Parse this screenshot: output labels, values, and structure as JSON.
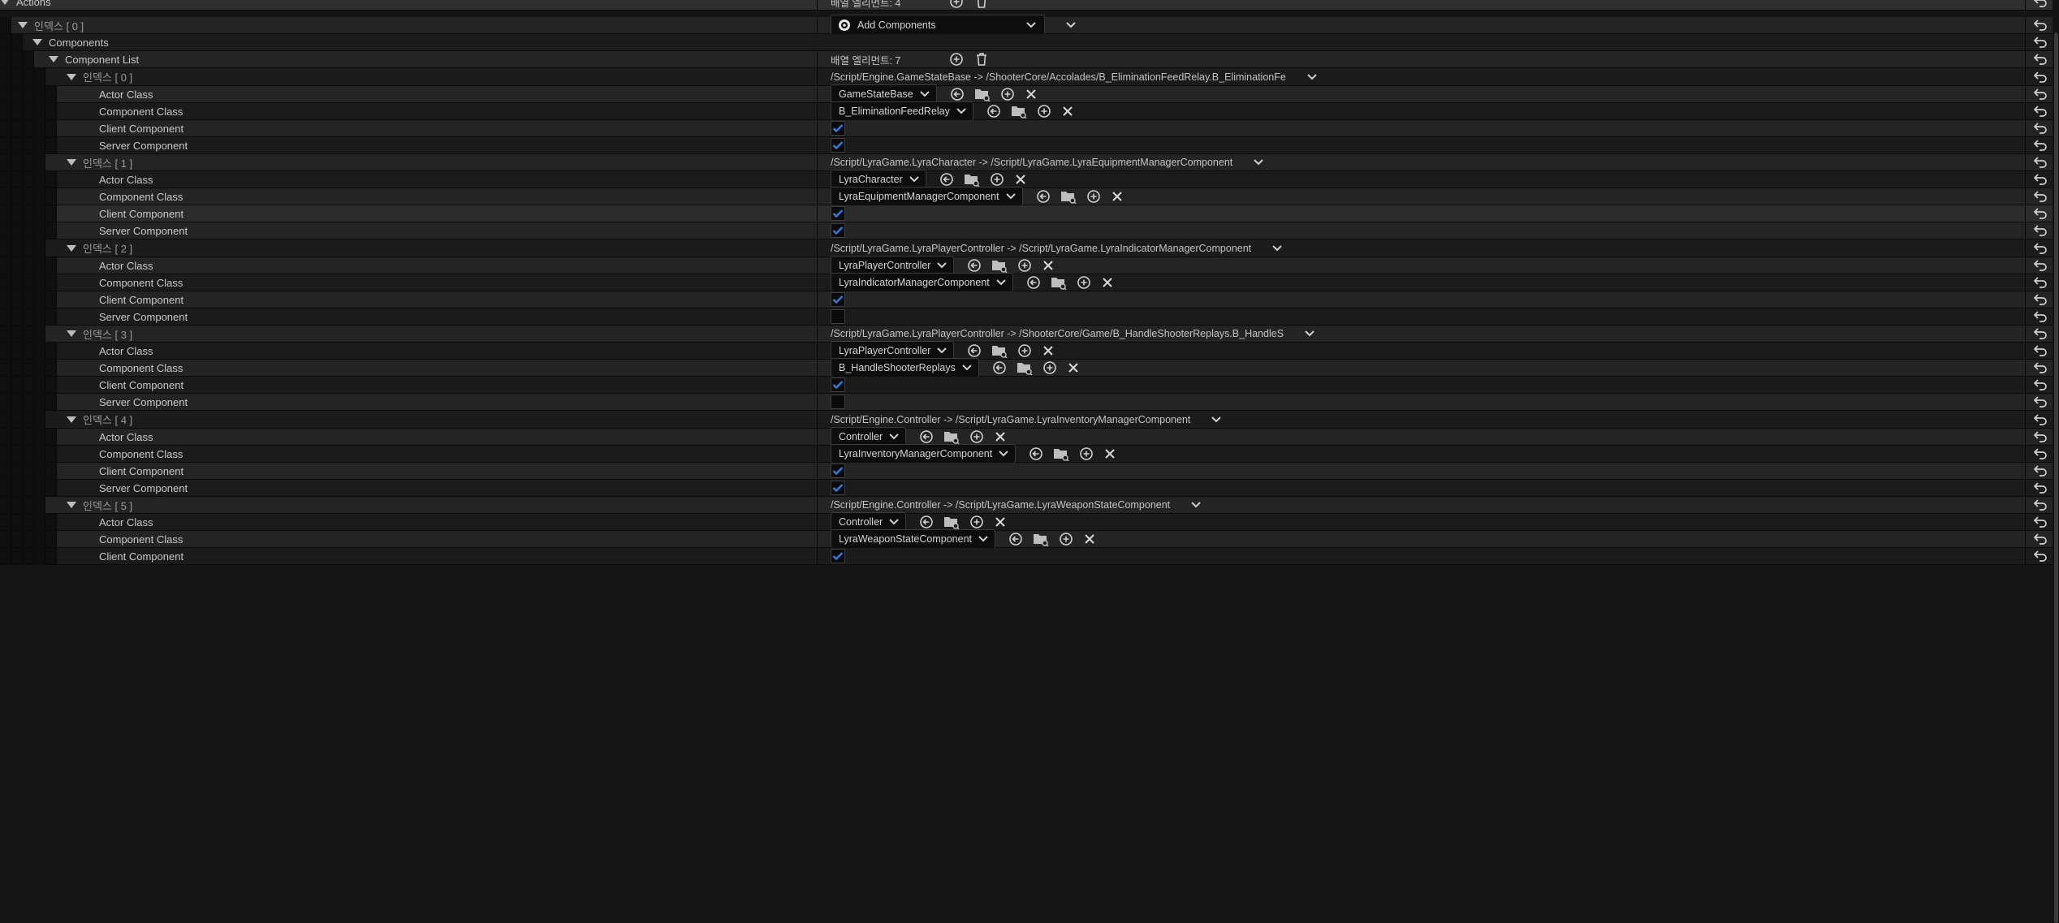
{
  "header": {
    "actions_label": "Actions",
    "actions_count": "배열 엘리먼트: 4",
    "index0_label": "인덱스 [ 0 ]",
    "add_components_label": "Add Components",
    "components_label": "Components",
    "component_list_label": "Component List",
    "component_list_count": "배열 엘리먼트: 7"
  },
  "labels": {
    "actor_class": "Actor Class",
    "component_class": "Component Class",
    "client_component": "Client Component",
    "server_component": "Server Component"
  },
  "entries": [
    {
      "index_label": "인덱스 [ 0 ]",
      "summary": "/Script/Engine.GameStateBase -> /ShooterCore/Accolades/B_EliminationFeedRelay.B_EliminationFe",
      "actor_class": "GameStateBase",
      "component_class": "B_EliminationFeedRelay",
      "client": true,
      "server": true
    },
    {
      "index_label": "인덱스 [ 1 ]",
      "summary": "/Script/LyraGame.LyraCharacter -> /Script/LyraGame.LyraEquipmentManagerComponent",
      "actor_class": "LyraCharacter",
      "component_class": "LyraEquipmentManagerComponent",
      "client": true,
      "server": true
    },
    {
      "index_label": "인덱스 [ 2 ]",
      "summary": "/Script/LyraGame.LyraPlayerController -> /Script/LyraGame.LyraIndicatorManagerComponent",
      "actor_class": "LyraPlayerController",
      "component_class": "LyraIndicatorManagerComponent",
      "client": true,
      "server": false
    },
    {
      "index_label": "인덱스 [ 3 ]",
      "summary": "/Script/LyraGame.LyraPlayerController -> /ShooterCore/Game/B_HandleShooterReplays.B_HandleS",
      "actor_class": "LyraPlayerController",
      "component_class": "B_HandleShooterReplays",
      "client": true,
      "server": false
    },
    {
      "index_label": "인덱스 [ 4 ]",
      "summary": "/Script/Engine.Controller -> /Script/LyraGame.LyraInventoryManagerComponent",
      "actor_class": "Controller",
      "component_class": "LyraInventoryManagerComponent",
      "client": true,
      "server": true
    },
    {
      "index_label": "인덱스 [ 5 ]",
      "summary": "/Script/Engine.Controller -> /Script/LyraGame.LyraWeaponStateComponent",
      "actor_class": "Controller",
      "component_class": "LyraWeaponStateComponent",
      "client": true,
      "server": null
    }
  ],
  "icons": {
    "expand": "triangle-down-icon",
    "dropdown": "chevron-down-icon",
    "use_selected": "arrow-left-circle-icon",
    "browse": "folder-browse-icon",
    "add": "plus-circle-icon",
    "clear": "close-icon",
    "delete": "trash-icon",
    "reset": "reset-arrow-icon",
    "checkbox": "check-icon",
    "component": "component-icon"
  },
  "colors": {
    "check": "#2b7de0",
    "row_dark": "#1b1b1b",
    "row_light": "#242424"
  }
}
